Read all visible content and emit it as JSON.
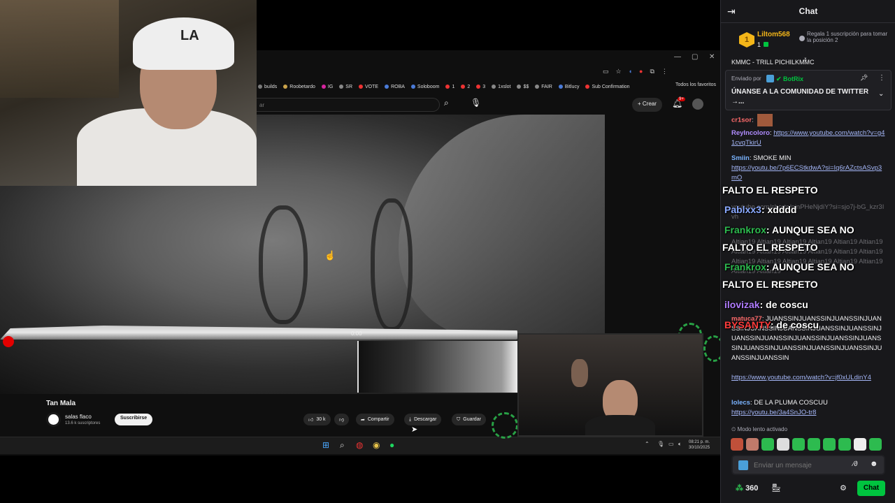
{
  "browser": {
    "bookmarks": [
      {
        "label": "builds",
        "color": "#7a7a7a"
      },
      {
        "label": "Roobetardo",
        "color": "#c9a24a"
      },
      {
        "label": "IG",
        "color": "#d6249f"
      },
      {
        "label": "SR",
        "color": "#888888"
      },
      {
        "label": "VOTE",
        "color": "#e33"
      },
      {
        "label": "ROBA",
        "color": "#4a7bd8"
      },
      {
        "label": "Soloboom",
        "color": "#4a7bd8"
      },
      {
        "label": "1",
        "color": "#e33"
      },
      {
        "label": "2",
        "color": "#e33"
      },
      {
        "label": "3",
        "color": "#e33"
      },
      {
        "label": "1xslot",
        "color": "#888888"
      },
      {
        "label": "$$",
        "color": "#888888"
      },
      {
        "label": "FAIR",
        "color": "#888888"
      },
      {
        "label": "Bitlucy",
        "color": "#4a7bd8"
      },
      {
        "label": "Sub Confirmation",
        "color": "#e33"
      }
    ],
    "favorites_label": "Todos los favoritos",
    "search_placeholder": "ar",
    "create_label": "Crear",
    "notif_badge": "9+"
  },
  "youtube": {
    "time": "0:00",
    "title": "Tan Mala",
    "channel": "salas flaco",
    "subscribers": "13.6 k suscriptores",
    "subscribe_label": "Suscribirse",
    "likes": "30 k",
    "share_label": "Compartir",
    "download_label": "Descargar",
    "save_label": "Guardar"
  },
  "taskbar": {
    "time": "08:21 p. m.",
    "date": "30/10/2025"
  },
  "chat": {
    "title": "Chat",
    "leader": {
      "name": "Liltom568",
      "rank": "1",
      "count": "1",
      "info": "Regala 1 suscripción para tomar la posición 2"
    },
    "scroll_text": "KMMC - TRILL PICHILKMMC",
    "pinned": {
      "by_label": "Enviado por",
      "bot": "BotRix",
      "text": "ÚNANSE A LA COMUNIDAD DE TWITTER →..."
    },
    "messages": [
      {
        "user": "cr1sor",
        "color": "#ff6b6b",
        "text": ":"
      },
      {
        "user": "ReyIncoloro",
        "color": "#b08cff",
        "text": ": ",
        "link": "https://www.youtube.com/watch?v=g41cvqTkirU"
      },
      {
        "user": "Smiin",
        "color": "#7ab3ff",
        "text": ": SMOKE MIN",
        "link": "https://youtu.be/7p6ECStkdwA?si=Iq6rAZctsASvp3mO"
      },
      {
        "user": "matuca77",
        "color": "#ff6b6b",
        "text": ": JUANSSINJUANSSINJUANSSINJUANSSINJUANSSINJUANSSINJUANSSINJUANSSINJUANSSINJUANSSINJUANSSINJUANSSINJUANSSINJUANSSINJUANSSINJUANSSINJUANSSINJUANSSINJUANSSIN",
        "link": "https://www.youtube.com/watch?v=jf0xULdinY4"
      },
      {
        "user": "lolecs",
        "color": "#7ab3ff",
        "text": ": DE LA PLUMA COSCUU",
        "link": "https://youtu.be/3a4SnJO-tr8"
      }
    ],
    "ghost": {
      "link": "youtube.com/shorts/pinPHeNjdiY?si=sjo7j-bG_kzr3Ivh",
      "spam": "Altian19 Altian19 Altian19 Altian19 Altian19 Altian19 Altian19 Altian19 Altian19 Altian19 Altian19 Altian19 Altian19 Altian19 Altian19 Altian19 Altian19 Altian19 Altian19 Altian19"
    },
    "overlay": [
      {
        "user": "",
        "color": "#ffffff",
        "text": "FALTO EL RESPETO"
      },
      {
        "user": "Pablxx3",
        "color": "#8aa9ff",
        "text": ": xdddd"
      },
      {
        "user": "Frankrox",
        "color": "#2dbb4f",
        "text": ": AUNQUE SEA NO"
      },
      {
        "user": "",
        "color": "#ffffff",
        "text": "FALTO EL RESPETO"
      },
      {
        "user": "Frankrox",
        "color": "#2dbb4f",
        "text": ": AUNQUE SEA NO"
      },
      {
        "user": "",
        "color": "#ffffff",
        "text": "FALTO EL RESPETO"
      },
      {
        "user": "ilovizak",
        "color": "#b07cff",
        "text": ": de coscu"
      },
      {
        "user": "BYSANTY",
        "color": "#ff3b3b",
        "text": ": de coscu"
      }
    ],
    "slow_mode": "Modo lento activado",
    "input_placeholder": "Enviar un mensaje",
    "points": "360",
    "send_label": "Chat"
  }
}
